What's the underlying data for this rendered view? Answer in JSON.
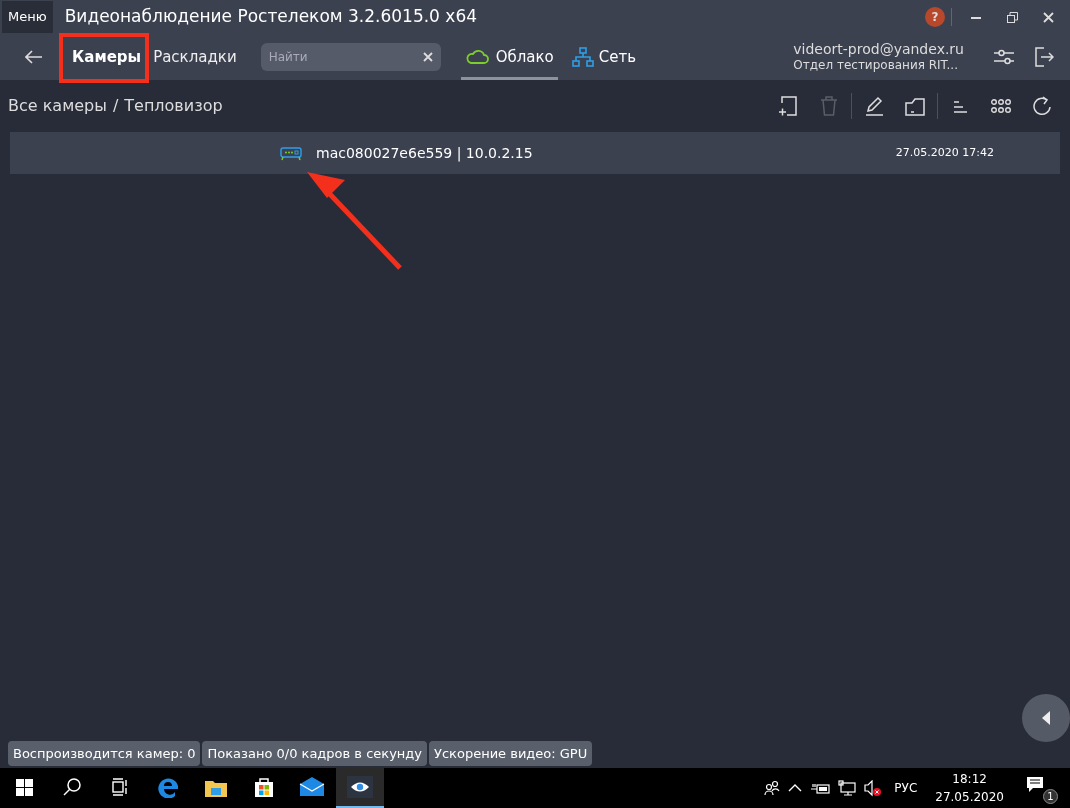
{
  "window": {
    "menu": "Меню",
    "title": "Видеонаблюдение Ростелеком 3.2.6015.0 x64",
    "help": "?"
  },
  "nav": {
    "tabs": [
      {
        "label": "Камеры",
        "selected": true
      },
      {
        "label": "Раскладки",
        "selected": false
      }
    ],
    "search": {
      "placeholder": "Найти"
    },
    "sources": [
      {
        "kind": "cloud",
        "label": "Облако",
        "selected": true
      },
      {
        "kind": "network",
        "label": "Сеть",
        "selected": false
      }
    ],
    "account": {
      "email": "videort-prod@yandex.ru",
      "org": "Отдел тестирования RIT..."
    }
  },
  "breadcrumb": {
    "parent": "Все камеры",
    "separator": "/",
    "current": "Тепловизор"
  },
  "toolbar": [
    {
      "kind": "add",
      "disabled": false
    },
    {
      "kind": "delete",
      "disabled": true
    },
    {
      "kind": "sep"
    },
    {
      "kind": "edit",
      "disabled": false
    },
    {
      "kind": "folder",
      "disabled": false
    },
    {
      "kind": "sep"
    },
    {
      "kind": "sort",
      "disabled": false
    },
    {
      "kind": "grid",
      "disabled": false
    },
    {
      "kind": "refresh",
      "disabled": false
    }
  ],
  "cameras": [
    {
      "name": "mac080027e6e559 | 10.0.2.15",
      "date": "27.05.2020 17:42"
    }
  ],
  "status_bar": [
    "Воспроизводится камер: 0",
    "Показано 0/0 кадров в секунду",
    "Ускорение видео: GPU"
  ],
  "taskbar": {
    "apps": [
      {
        "kind": "start",
        "selected": false
      },
      {
        "kind": "search",
        "selected": false
      },
      {
        "kind": "taskview",
        "selected": false
      },
      {
        "kind": "edge",
        "selected": false
      },
      {
        "kind": "explorer",
        "selected": false
      },
      {
        "kind": "store",
        "selected": false
      },
      {
        "kind": "mail",
        "selected": false
      },
      {
        "kind": "eye",
        "selected": true
      }
    ],
    "language": "РУС",
    "time": "18:12",
    "date": "27.05.2020",
    "notifications": "1"
  }
}
